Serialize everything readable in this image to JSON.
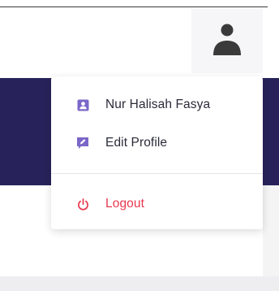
{
  "header": {
    "avatar_icon": "user-avatar-icon"
  },
  "dropdown": {
    "items": [
      {
        "icon": "user-badge-icon",
        "label": "Nur Halisah Fasya",
        "color": "#7b67c9",
        "text_color": "#2b2b3a"
      },
      {
        "icon": "edit-profile-icon",
        "label": "Edit Profile",
        "color": "#7b67c9",
        "text_color": "#2b2b3a"
      }
    ],
    "logout": {
      "icon": "power-icon",
      "label": "Logout",
      "color": "#e8384f"
    }
  },
  "colors": {
    "banner": "#27235a",
    "accent": "#7b67c9",
    "danger": "#e8384f"
  }
}
